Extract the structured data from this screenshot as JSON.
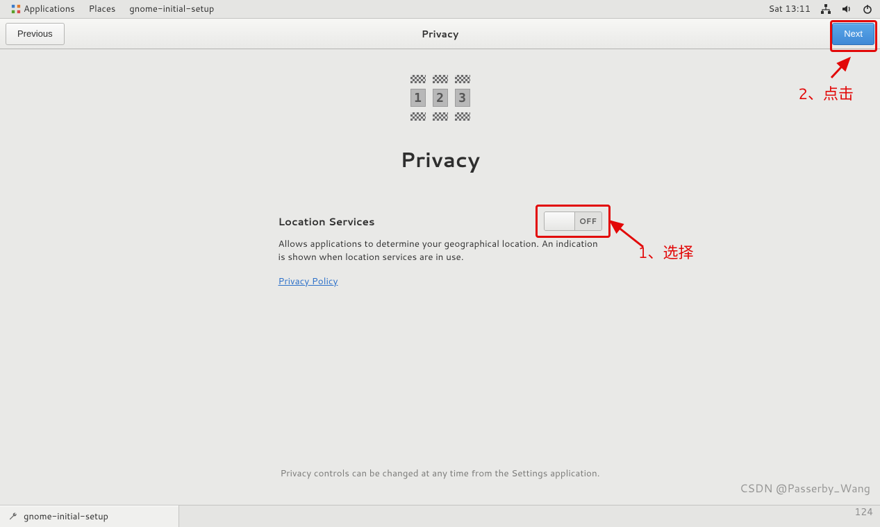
{
  "panel": {
    "applications": "Applications",
    "places": "Places",
    "app_name": "gnome-initial-setup",
    "clock": "Sat 13:11"
  },
  "header": {
    "previous": "Previous",
    "title": "Privacy",
    "next": "Next"
  },
  "page": {
    "icon_numbers": [
      "1",
      "2",
      "3"
    ],
    "title": "Privacy",
    "setting_label": "Location Services",
    "switch_state": "OFF",
    "setting_desc": "Allows applications to determine your geographical location. An indication is shown when location services are in use.",
    "privacy_link": "Privacy Policy",
    "footer": "Privacy controls can be changed at any time from the Settings application."
  },
  "taskbar": {
    "task1": "gnome-initial-setup"
  },
  "annotations": {
    "step1": "1、选择",
    "step2": "2、点击"
  },
  "watermark": "CSDN @Passerby_Wang",
  "page_indicator": "124"
}
